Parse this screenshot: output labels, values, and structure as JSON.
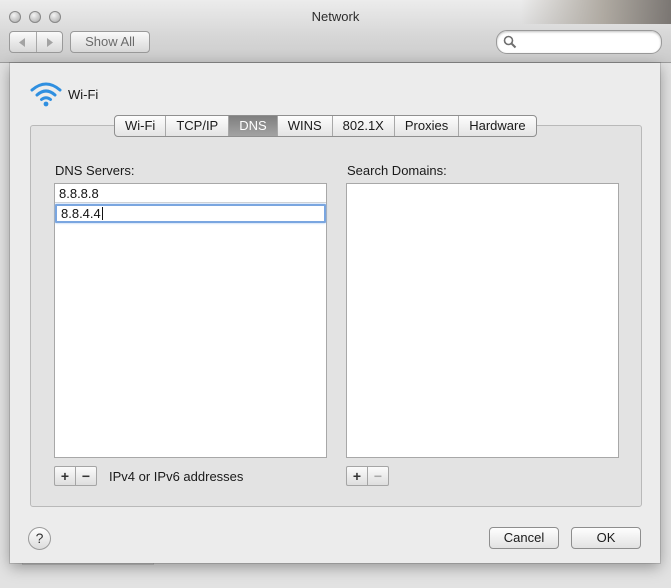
{
  "window": {
    "title": "Network"
  },
  "toolbar": {
    "back_icon": "chevron-left-icon",
    "forward_icon": "chevron-right-icon",
    "show_all_label": "Show All",
    "search_value": "",
    "search_placeholder": ""
  },
  "sheet": {
    "interface_name": "Wi-Fi",
    "tabs": [
      {
        "label": "Wi-Fi",
        "active": false
      },
      {
        "label": "TCP/IP",
        "active": false
      },
      {
        "label": "DNS",
        "active": true
      },
      {
        "label": "WINS",
        "active": false
      },
      {
        "label": "802.1X",
        "active": false
      },
      {
        "label": "Proxies",
        "active": false
      },
      {
        "label": "Hardware",
        "active": false
      }
    ],
    "dns_servers_label": "DNS Servers:",
    "dns_servers": [
      "8.8.8.8",
      "8.8.4.4"
    ],
    "search_domains_label": "Search Domains:",
    "search_domains": [],
    "add_label": "+",
    "remove_label": "−",
    "address_hint": "IPv4 or IPv6 addresses",
    "help_label": "?",
    "cancel_label": "Cancel",
    "ok_label": "OK"
  },
  "colors": {
    "active_tab": "#8f8f8f",
    "edit_focus_ring": "#7aa6e0",
    "window_bg": "#ececec"
  }
}
